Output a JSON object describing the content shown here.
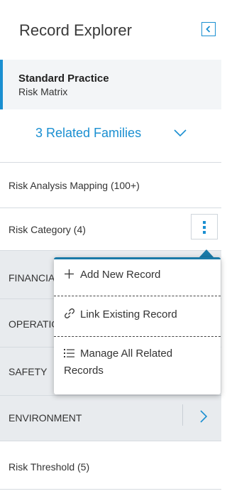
{
  "header": {
    "title": "Record Explorer"
  },
  "record": {
    "family": "Standard Practice",
    "name": "Risk Matrix"
  },
  "related": {
    "label": "3 Related Families"
  },
  "families": [
    {
      "label": "Risk Analysis Mapping (100+)"
    },
    {
      "label": "Risk Category  (4)"
    },
    {
      "label": "FINANCIAL"
    },
    {
      "label": "OPERATIONS"
    },
    {
      "label": "SAFETY"
    },
    {
      "label": "ENVIRONMENT"
    },
    {
      "label": "Risk Threshold (5)"
    }
  ],
  "menu": {
    "items": [
      {
        "label": "Add New Record",
        "icon": "plus-icon"
      },
      {
        "label": "Link Existing Record",
        "icon": "link-icon"
      },
      {
        "label_line1": "Manage All Related",
        "label_line2": "Records",
        "icon": "list-icon"
      }
    ]
  },
  "colors": {
    "accent": "#1a8fd1",
    "menu_bar": "#1a7aa8",
    "grey_row": "#e8ebee"
  }
}
